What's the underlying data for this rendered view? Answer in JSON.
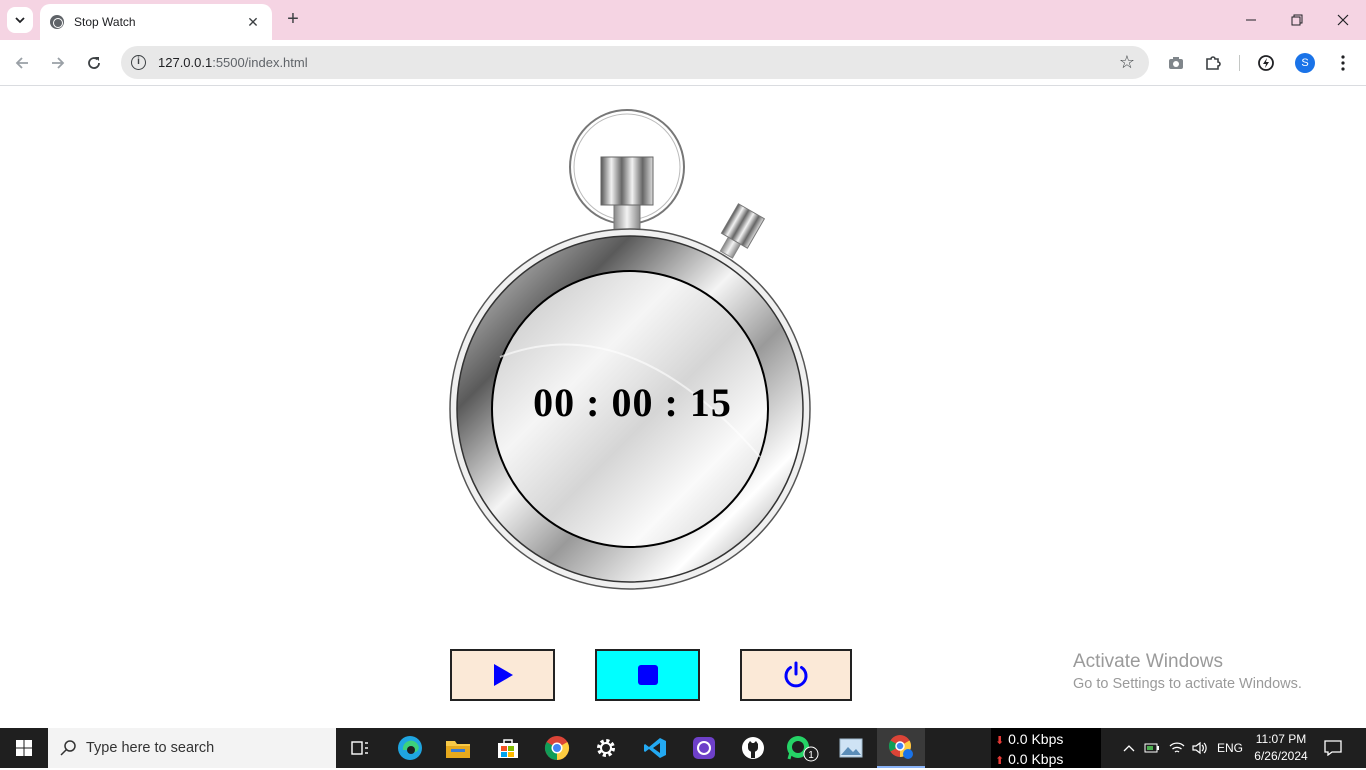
{
  "browser": {
    "tab_title": "Stop Watch",
    "tab_close": "✕",
    "new_tab": "+",
    "url_host": "127.0.0.1",
    "url_rest": ":5500/index.html",
    "profile_initial": "S"
  },
  "stopwatch": {
    "time_display": "00 : 00 : 15",
    "buttons": [
      {
        "name": "start",
        "icon": "play-icon",
        "bg": "#fbe9d7"
      },
      {
        "name": "stop",
        "icon": "stop-icon",
        "bg": "#00ffff"
      },
      {
        "name": "reset",
        "icon": "power-icon",
        "bg": "#fbe9d7"
      }
    ],
    "icon_color": "#0000ff"
  },
  "watermark": {
    "line1": "Activate Windows",
    "line2": "Go to Settings to activate Windows."
  },
  "taskbar": {
    "search_placeholder": "Type here to search",
    "apps": [
      "task-view-icon",
      "edge-icon",
      "file-explorer-icon",
      "store-icon",
      "chrome-icon",
      "settings-icon",
      "vscode-icon",
      "github-desktop-icon",
      "github-icon",
      "whatsapp-icon",
      "photos-icon",
      "chrome-profile-icon"
    ],
    "whatsapp_badge": "1",
    "net_down": "0.0 Kbps",
    "net_up": "0.0 Kbps",
    "language": "ENG",
    "time": "11:07 PM",
    "date": "6/26/2024"
  }
}
